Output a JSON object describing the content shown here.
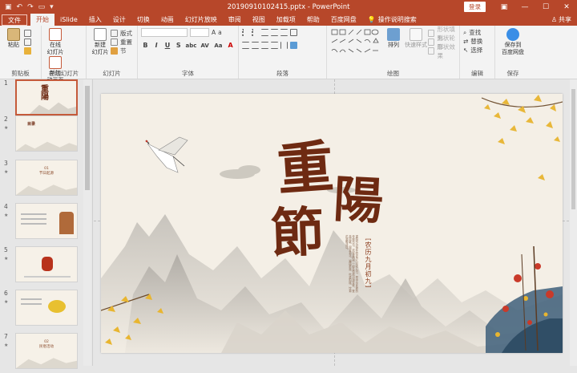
{
  "window": {
    "title": "20190910102415.pptx - PowerPoint",
    "login": "登录",
    "share": "共享",
    "search_placeholder": "操作说明搜索"
  },
  "tabs": [
    {
      "label": "文件"
    },
    {
      "label": "开始"
    },
    {
      "label": "iSlide"
    },
    {
      "label": "插入"
    },
    {
      "label": "设计"
    },
    {
      "label": "切换"
    },
    {
      "label": "动画"
    },
    {
      "label": "幻灯片放映"
    },
    {
      "label": "审阅"
    },
    {
      "label": "视图"
    },
    {
      "label": "加载项"
    },
    {
      "label": "帮助"
    },
    {
      "label": "百度网盘"
    }
  ],
  "ribbon": {
    "clipboard": {
      "label": "剪贴板",
      "paste": "粘贴"
    },
    "online_slides": {
      "label": "在线幻灯片",
      "online": "在线\n幻灯片",
      "new_anim": "新加\n动画页"
    },
    "slides": {
      "label": "幻灯片",
      "new": "新建\n幻灯片",
      "layout": "版式",
      "reset": "重置",
      "section": "节"
    },
    "font": {
      "label": "字体",
      "bold": "B",
      "italic": "I",
      "underline": "U",
      "shadow": "S",
      "strike": "abc",
      "spacing": "AV",
      "case": "Aa",
      "color": "A"
    },
    "paragraph": {
      "label": "段落"
    },
    "drawing": {
      "label": "绘图",
      "arrange": "排列",
      "quick_styles": "快速样式",
      "fill": "形状填充",
      "outline": "形状轮廓",
      "effects": "形状效果"
    },
    "editing": {
      "label": "编辑",
      "find": "查找",
      "replace": "替换",
      "select": "选择"
    },
    "save": {
      "label": "保存",
      "save_cloud": "保存到\n百度网盘"
    }
  },
  "thumbnails": [
    {
      "num": "1",
      "star": "★"
    },
    {
      "num": "2",
      "star": "★",
      "text": "目录"
    },
    {
      "num": "3",
      "star": "★",
      "text": "01\n节日起源"
    },
    {
      "num": "4",
      "star": "★"
    },
    {
      "num": "5",
      "star": "★"
    },
    {
      "num": "6",
      "star": "★"
    },
    {
      "num": "7",
      "star": "★",
      "text": "02\n民俗活动"
    }
  ],
  "slide": {
    "title_chars": [
      "重",
      "陽",
      "節"
    ],
    "subtitle": "[农历九月初九]",
    "body": "重阳节为每年的农历九月初九日，是中华民族的传统节日。庆祝重阳节一般会包括出游赏秋、登高远眺、观赏菊花、遍插茱萸、吃重阳糕、饮菊花酒等活动。"
  }
}
